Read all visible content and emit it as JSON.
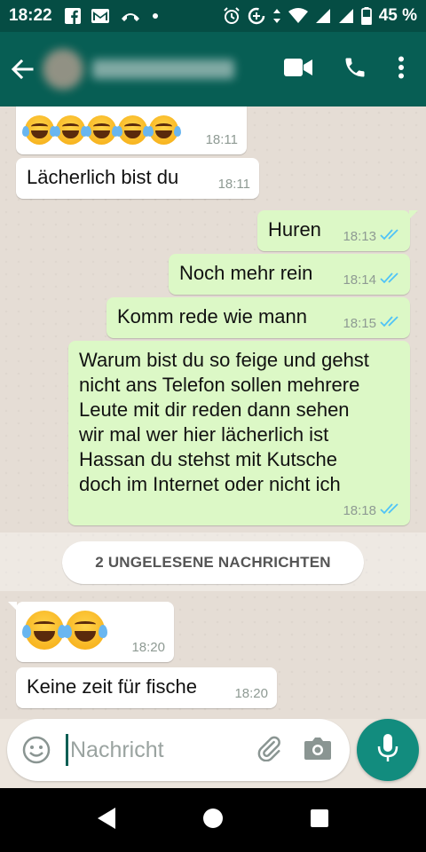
{
  "status_bar": {
    "time": "18:22",
    "battery": "45 %",
    "icons": [
      "facebook-icon",
      "gmail-icon",
      "missed-call-icon",
      "dot-icon",
      "alarm-icon",
      "data-saver-icon",
      "data-arrows-icon",
      "wifi-icon",
      "signal-icon",
      "signal-icon",
      "battery-icon"
    ]
  },
  "header": {
    "contact_name_hidden": true,
    "icons": [
      "back-arrow-icon",
      "video-call-icon",
      "voice-call-icon",
      "more-vert-icon"
    ]
  },
  "messages": [
    {
      "dir": "in",
      "text": "",
      "emoji_count": 5,
      "time": "18:11"
    },
    {
      "dir": "in",
      "text": "Lächerlich bist du",
      "time": "18:11"
    },
    {
      "dir": "out",
      "text": "Huren",
      "time": "18:13",
      "read": true
    },
    {
      "dir": "out",
      "text": "Noch mehr rein",
      "time": "18:14",
      "read": true
    },
    {
      "dir": "out",
      "text": "Komm rede wie mann",
      "time": "18:15",
      "read": true
    },
    {
      "dir": "out",
      "lines": [
        "Warum bist du so feige und gehst",
        "nicht ans Telefon sollen mehrere",
        "Leute mit dir reden dann sehen",
        "wir mal wer hier lächerlich ist",
        "Hassan du stehst mit Kutsche",
        "doch im Internet oder nicht ich"
      ],
      "time": "18:18",
      "read": true
    },
    {
      "dir": "in",
      "text": "",
      "emoji_count": 2,
      "time": "18:20"
    },
    {
      "dir": "in",
      "text": "Keine zeit für fische",
      "time": "18:20"
    }
  ],
  "unread_banner": "2 UNGELESENE NACHRICHTEN",
  "composer": {
    "placeholder": "Nachricht"
  },
  "colors": {
    "status_bar": "#054d44",
    "app_bar": "#075e54",
    "outgoing_bubble": "#dcf8c6",
    "incoming_bubble": "#ffffff",
    "read_ticks": "#4fc3f7",
    "mic_button": "#128c7e",
    "chat_background": "#e5ddd5"
  }
}
